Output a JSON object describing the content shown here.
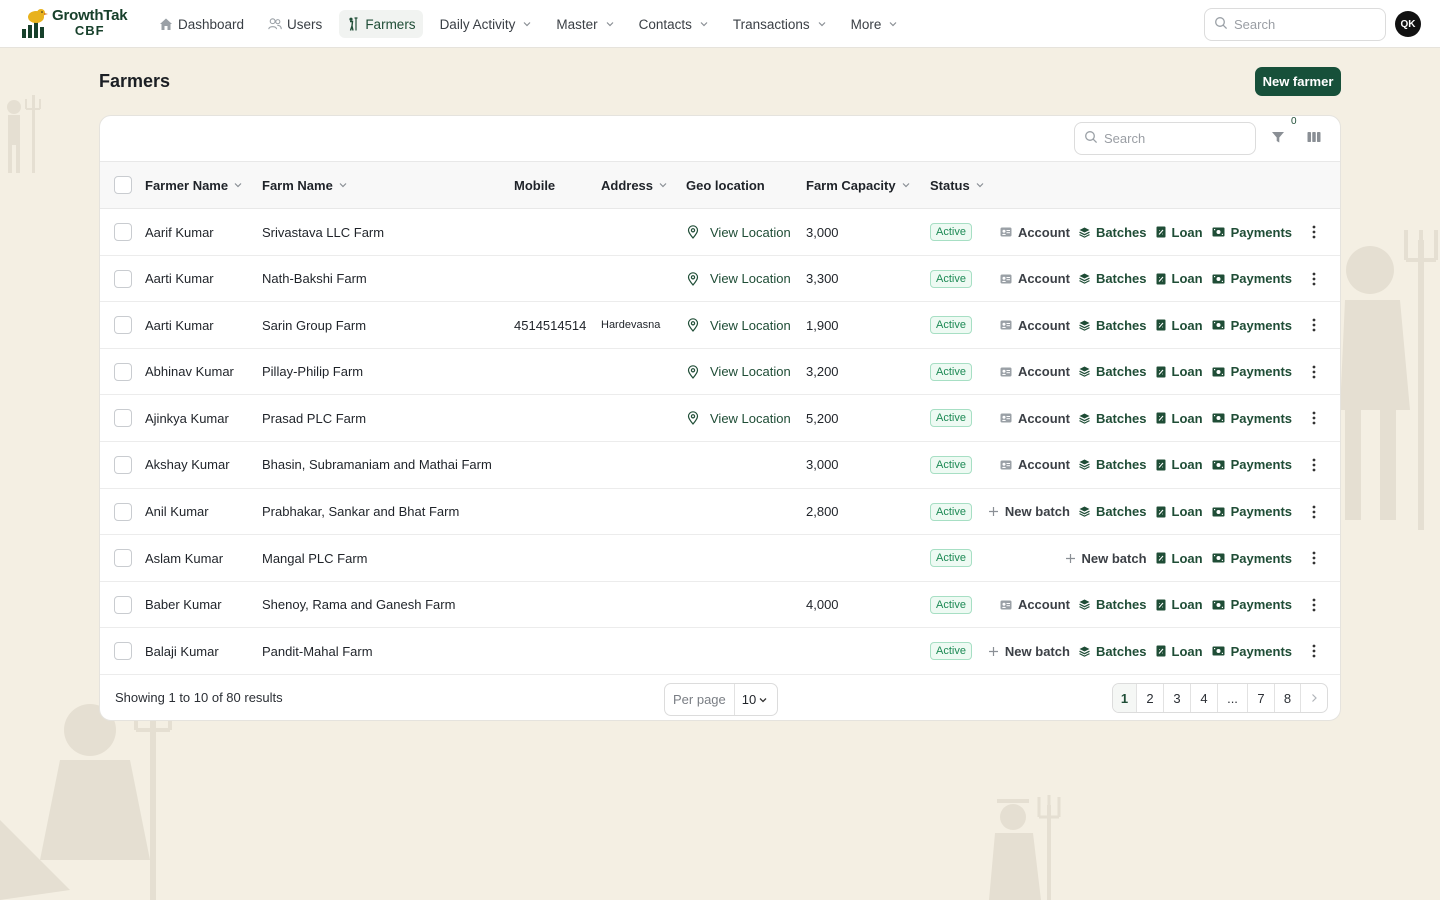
{
  "app": {
    "logo_line1": "GrowthTak",
    "logo_line2": "CBF"
  },
  "nav": [
    {
      "label": "Dashboard",
      "icon": "home-icon",
      "dropdown": false,
      "active": false
    },
    {
      "label": "Users",
      "icon": "users-icon",
      "dropdown": false,
      "active": false
    },
    {
      "label": "Farmers",
      "icon": "farmer-icon",
      "dropdown": false,
      "active": true
    },
    {
      "label": "Daily Activity",
      "dropdown": true,
      "active": false
    },
    {
      "label": "Master",
      "dropdown": true,
      "active": false
    },
    {
      "label": "Contacts",
      "dropdown": true,
      "active": false
    },
    {
      "label": "Transactions",
      "dropdown": true,
      "active": false
    },
    {
      "label": "More",
      "dropdown": true,
      "active": false
    }
  ],
  "header": {
    "search_placeholder": "Search",
    "avatar_initials": "QK"
  },
  "page": {
    "title": "Farmers",
    "new_button": "New farmer"
  },
  "table": {
    "search_placeholder": "Search",
    "filter_count": "0",
    "columns": [
      {
        "label": "Farmer Name",
        "sortable": true
      },
      {
        "label": "Farm Name",
        "sortable": true
      },
      {
        "label": "Mobile",
        "sortable": false
      },
      {
        "label": "Address",
        "sortable": true
      },
      {
        "label": "Geo location",
        "sortable": false
      },
      {
        "label": "Farm Capacity",
        "sortable": true
      },
      {
        "label": "Status",
        "sortable": true
      }
    ],
    "rows": [
      {
        "farmer": "Aarif Kumar",
        "farm": "Srivastava LLC Farm",
        "mobile": "",
        "address": "",
        "geo": "View Location",
        "capacity": "3,000",
        "status": "Active",
        "actions": [
          "Account",
          "Batches",
          "Loan",
          "Payments"
        ]
      },
      {
        "farmer": "Aarti Kumar",
        "farm": "Nath-Bakshi Farm",
        "mobile": "",
        "address": "",
        "geo": "View Location",
        "capacity": "3,300",
        "status": "Active",
        "actions": [
          "Account",
          "Batches",
          "Loan",
          "Payments"
        ]
      },
      {
        "farmer": "Aarti Kumar",
        "farm": "Sarin Group Farm",
        "mobile": "4514514514",
        "address": "Hardevasna",
        "geo": "View Location",
        "capacity": "1,900",
        "status": "Active",
        "actions": [
          "Account",
          "Batches",
          "Loan",
          "Payments"
        ]
      },
      {
        "farmer": "Abhinav Kumar",
        "farm": "Pillay-Philip Farm",
        "mobile": "",
        "address": "",
        "geo": "View Location",
        "capacity": "3,200",
        "status": "Active",
        "actions": [
          "Account",
          "Batches",
          "Loan",
          "Payments"
        ]
      },
      {
        "farmer": "Ajinkya Kumar",
        "farm": "Prasad PLC Farm",
        "mobile": "",
        "address": "",
        "geo": "View Location",
        "capacity": "5,200",
        "status": "Active",
        "actions": [
          "Account",
          "Batches",
          "Loan",
          "Payments"
        ]
      },
      {
        "farmer": "Akshay Kumar",
        "farm": "Bhasin, Subramaniam and Mathai Farm",
        "mobile": "",
        "address": "",
        "geo": "",
        "capacity": "3,000",
        "status": "Active",
        "actions": [
          "Account",
          "Batches",
          "Loan",
          "Payments"
        ]
      },
      {
        "farmer": "Anil Kumar",
        "farm": "Prabhakar, Sankar and Bhat Farm",
        "mobile": "",
        "address": "",
        "geo": "",
        "capacity": "2,800",
        "status": "Active",
        "actions": [
          "New batch",
          "Batches",
          "Loan",
          "Payments"
        ]
      },
      {
        "farmer": "Aslam Kumar",
        "farm": "Mangal PLC Farm",
        "mobile": "",
        "address": "",
        "geo": "",
        "capacity": "",
        "status": "Active",
        "actions": [
          "New batch",
          "Loan",
          "Payments"
        ]
      },
      {
        "farmer": "Baber Kumar",
        "farm": "Shenoy, Rama and Ganesh Farm",
        "mobile": "",
        "address": "",
        "geo": "",
        "capacity": "4,000",
        "status": "Active",
        "actions": [
          "Account",
          "Batches",
          "Loan",
          "Payments"
        ]
      },
      {
        "farmer": "Balaji Kumar",
        "farm": "Pandit-Mahal Farm",
        "mobile": "",
        "address": "",
        "geo": "",
        "capacity": "",
        "status": "Active",
        "actions": [
          "New batch",
          "Batches",
          "Loan",
          "Payments"
        ]
      }
    ]
  },
  "footer": {
    "showing": "Showing 1 to 10 of 80 results",
    "per_page_label": "Per page",
    "per_page_value": "10",
    "pages": [
      "1",
      "2",
      "3",
      "4",
      "...",
      "7",
      "8"
    ],
    "current_page": "1"
  },
  "colors": {
    "accent": "#17503a",
    "background": "#f4efe3",
    "status_active": "#1d8a55"
  }
}
